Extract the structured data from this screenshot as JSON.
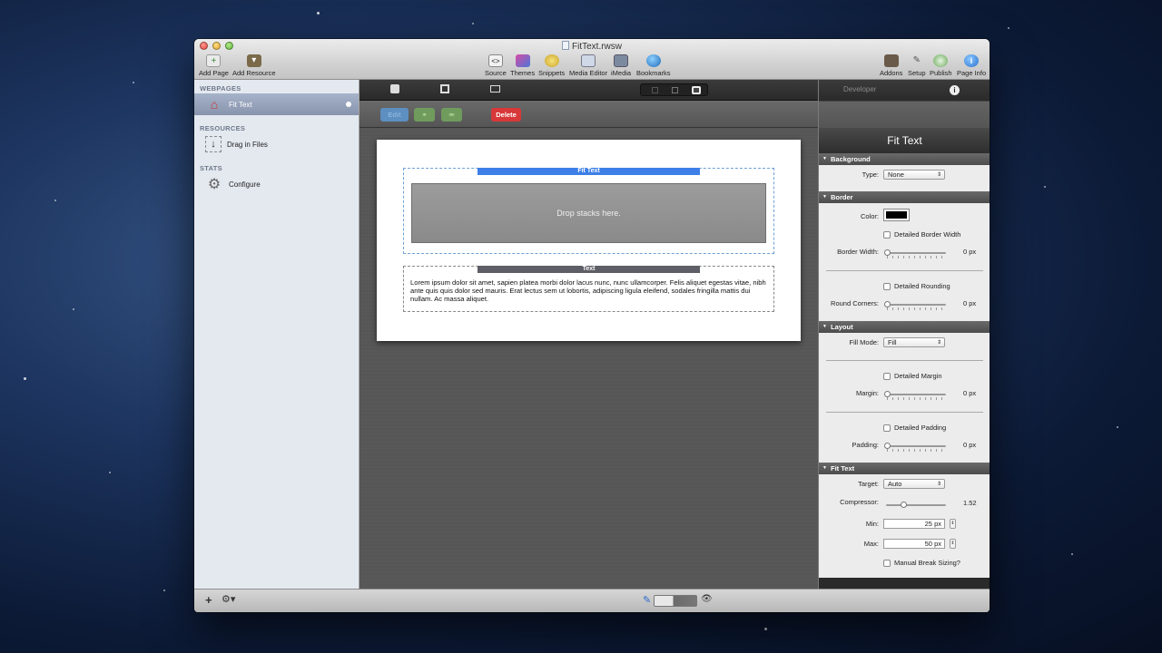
{
  "window": {
    "title": "FitText.rwsw"
  },
  "toolbar": {
    "add_page": "Add Page",
    "add_resource": "Add Resource",
    "source": "Source",
    "themes": "Themes",
    "snippets": "Snippets",
    "media_editor": "Media Editor",
    "imedia": "iMedia",
    "bookmarks": "Bookmarks",
    "addons": "Addons",
    "setup": "Setup",
    "publish": "Publish",
    "page_info": "Page Info"
  },
  "sidebar": {
    "webpages_heading": "WEBPAGES",
    "page_item": "Fit Text",
    "resources_heading": "RESOURCES",
    "resources_item": "Drag in Files",
    "stats_heading": "STATS",
    "stats_item": "Configure"
  },
  "editor": {
    "edit_button": "Edit",
    "delete_button": "Delete",
    "fit_text_stack_label": "Fit Text",
    "drop_zone_text": "Drop stacks here.",
    "text_stack_label": "Text",
    "body_text": "Lorem ipsum dolor sit amet, sapien platea morbi dolor lacus nunc, nunc ullamcorper. Felis aliquet egestas vitae, nibh ante quis quis dolor sed mauris. Erat lectus sem ut lobortis, adipiscing ligula eleifend, sodales fringilla mattis dui nullam. Ac massa aliquet."
  },
  "inspector": {
    "tab_developer": "Developer",
    "title": "Fit Text",
    "background": {
      "heading": "Background",
      "type_label": "Type:",
      "type_value": "None"
    },
    "border": {
      "heading": "Border",
      "color_label": "Color:",
      "color_value": "#000000",
      "detailed_width": "Detailed Border Width",
      "width_label": "Border Width:",
      "width_value": "0 px",
      "detailed_rounding": "Detailed Rounding",
      "corners_label": "Round Corners:",
      "corners_value": "0 px"
    },
    "layout": {
      "heading": "Layout",
      "fill_label": "Fill Mode:",
      "fill_value": "Fill",
      "detailed_margin": "Detailed Margin",
      "margin_label": "Margin:",
      "margin_value": "0 px",
      "detailed_padding": "Detailed Padding",
      "padding_label": "Padding:",
      "padding_value": "0 px"
    },
    "fit_text": {
      "heading": "Fit Text",
      "target_label": "Target:",
      "target_value": "Auto",
      "compressor_label": "Compressor:",
      "compressor_value": "1.52",
      "min_label": "Min:",
      "min_value": "25 px",
      "max_label": "Max:",
      "max_value": "50 px",
      "manual_break": "Manual Break Sizing?"
    }
  },
  "colors": {
    "accent_blue": "#3d7fe6",
    "delete_red": "#d8383a",
    "text_stack_label": "#5e5e66"
  }
}
